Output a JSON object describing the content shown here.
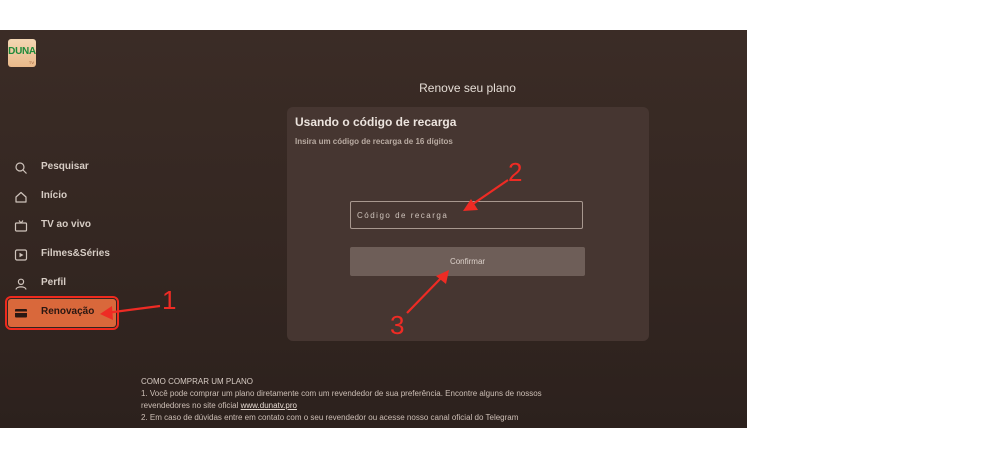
{
  "app": {
    "logo_text": "DUNA",
    "logo_sub": "TV"
  },
  "sidebar": {
    "items": [
      {
        "label": "Pesquisar",
        "icon": "search-icon"
      },
      {
        "label": "Início",
        "icon": "home-icon"
      },
      {
        "label": "TV ao vivo",
        "icon": "tv-icon"
      },
      {
        "label": "Filmes&Séries",
        "icon": "play-icon"
      },
      {
        "label": "Perfil",
        "icon": "user-icon"
      },
      {
        "label": "Renovação",
        "icon": "card-icon",
        "active": true
      }
    ]
  },
  "main": {
    "title": "Renove seu plano",
    "card": {
      "title": "Usando o código de recarga",
      "subtitle": "Insira um código de recarga de 16 dígitos",
      "input_placeholder": "Código de recarga",
      "confirm_label": "Confirmar"
    },
    "howto": {
      "title": "COMO COMPRAR UM PLANO",
      "line1": "1. Você pode comprar um plano diretamente com um revendedor de sua preferência. Encontre alguns de nossos",
      "line2_text": "revendedores no site oficial",
      "link": "www.dunatv.pro",
      "line3": "2. Em caso de dúvidas entre em contato com o seu revendedor ou acesse nosso canal oficial do Telegram"
    }
  },
  "annotations": {
    "one": "1",
    "two": "2",
    "three": "3"
  },
  "colors": {
    "accent": "#d9683b",
    "annotation": "#ee2b24",
    "background": "#3b2c26"
  }
}
